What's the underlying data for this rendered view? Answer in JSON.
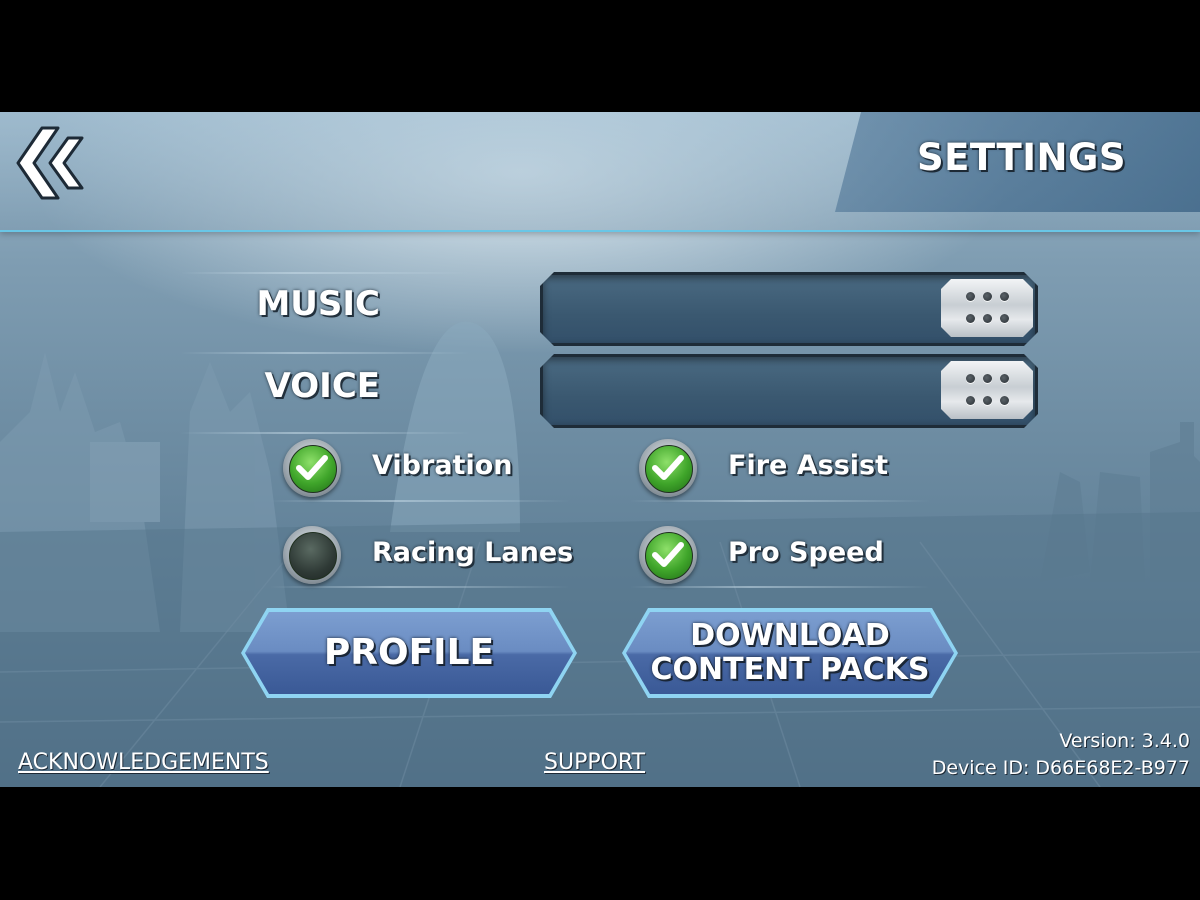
{
  "header": {
    "title": "SETTINGS",
    "back_icon": "double-chevron-left-icon"
  },
  "sliders": [
    {
      "label": "MUSIC",
      "level": 1.0
    },
    {
      "label": "VOICE",
      "level": 1.0
    }
  ],
  "options": [
    {
      "label": "Vibration",
      "checked": true
    },
    {
      "label": "Fire Assist",
      "checked": true
    },
    {
      "label": "Racing Lanes",
      "checked": false
    },
    {
      "label": "Pro Speed",
      "checked": true
    }
  ],
  "buttons": {
    "profile": "PROFILE",
    "download_line1": "DOWNLOAD",
    "download_line2": "CONTENT PACKS"
  },
  "footer": {
    "acknowledgements": "ACKNOWLEDGEMENTS",
    "support": "SUPPORT",
    "version": "Version: 3.4.0",
    "device_id": "Device ID: D66E68E2-B977"
  },
  "colors": {
    "accent": "#69c6e6",
    "check_on": "#3fa52a",
    "button_face": "#6a8cc2"
  }
}
